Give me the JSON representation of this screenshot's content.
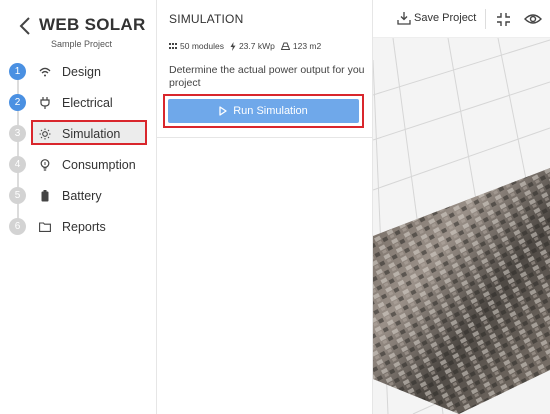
{
  "brand": {
    "title": "WEB SOLAR",
    "subtitle": "Sample Project"
  },
  "steps": [
    {
      "num": "1",
      "label": "Design",
      "state": "done",
      "icon": "wifi-icon"
    },
    {
      "num": "2",
      "label": "Electrical",
      "state": "done",
      "icon": "plug-icon"
    },
    {
      "num": "3",
      "label": "Simulation",
      "state": "active",
      "icon": "sun-icon"
    },
    {
      "num": "4",
      "label": "Consumption",
      "state": "todo",
      "icon": "bulb-icon"
    },
    {
      "num": "5",
      "label": "Battery",
      "state": "todo",
      "icon": "battery-icon"
    },
    {
      "num": "6",
      "label": "Reports",
      "state": "todo",
      "icon": "folder-icon"
    }
  ],
  "panel": {
    "title": "SIMULATION",
    "stats": {
      "modules": "50 modules",
      "power": "23.7 kWp",
      "area": "123 m2"
    },
    "description": "Determine the actual power output for you project",
    "run_label": "Run Simulation"
  },
  "toolbar": {
    "save_label": "Save Project"
  },
  "colors": {
    "accent": "#4a90e2",
    "run_button": "#6fa8ea",
    "highlight_border": "#d9262c",
    "step_todo": "#d3d3d3"
  }
}
